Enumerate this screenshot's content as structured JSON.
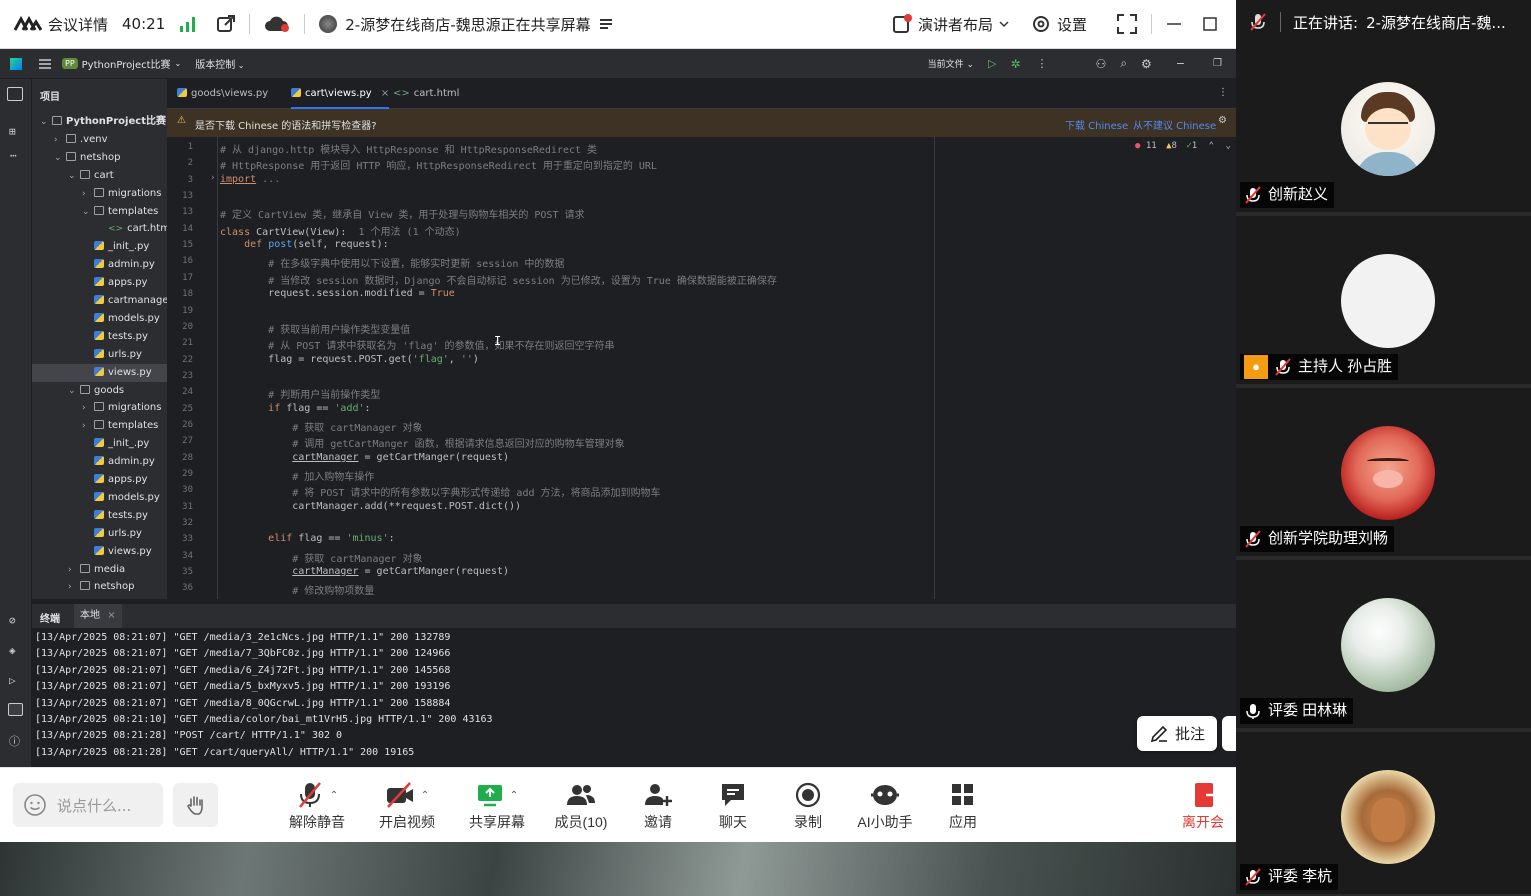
{
  "meeting": {
    "details_label": "会议详情",
    "timer": "40:21",
    "share_status": "2-源梦在线商店-魏思源正在共享屏幕",
    "layout_label": "演讲者布局",
    "settings_label": "设置"
  },
  "ide": {
    "project_name": "PythonProject比赛",
    "vcs_label": "版本控制",
    "run_config": "当前文件",
    "panel_title": "项目",
    "tree": [
      {
        "label": "PythonProject比赛",
        "depth": 0,
        "type": "folder",
        "open": true
      },
      {
        "label": ".venv",
        "depth": 1,
        "type": "folder",
        "open": false
      },
      {
        "label": "netshop",
        "depth": 1,
        "type": "folder",
        "open": true
      },
      {
        "label": "cart",
        "depth": 2,
        "type": "folder",
        "open": true
      },
      {
        "label": "migrations",
        "depth": 3,
        "type": "folder",
        "open": false
      },
      {
        "label": "templates",
        "depth": 3,
        "type": "folder",
        "open": true
      },
      {
        "label": "cart.html",
        "depth": 4,
        "type": "html"
      },
      {
        "label": "_init_.py",
        "depth": 3,
        "type": "py"
      },
      {
        "label": "admin.py",
        "depth": 3,
        "type": "py"
      },
      {
        "label": "apps.py",
        "depth": 3,
        "type": "py"
      },
      {
        "label": "cartmanager",
        "depth": 3,
        "type": "py"
      },
      {
        "label": "models.py",
        "depth": 3,
        "type": "py"
      },
      {
        "label": "tests.py",
        "depth": 3,
        "type": "py"
      },
      {
        "label": "urls.py",
        "depth": 3,
        "type": "py"
      },
      {
        "label": "views.py",
        "depth": 3,
        "type": "py",
        "selected": true
      },
      {
        "label": "goods",
        "depth": 2,
        "type": "folder",
        "open": true
      },
      {
        "label": "migrations",
        "depth": 3,
        "type": "folder",
        "open": false
      },
      {
        "label": "templates",
        "depth": 3,
        "type": "folder",
        "open": false
      },
      {
        "label": "_init_.py",
        "depth": 3,
        "type": "py"
      },
      {
        "label": "admin.py",
        "depth": 3,
        "type": "py"
      },
      {
        "label": "apps.py",
        "depth": 3,
        "type": "py"
      },
      {
        "label": "models.py",
        "depth": 3,
        "type": "py"
      },
      {
        "label": "tests.py",
        "depth": 3,
        "type": "py"
      },
      {
        "label": "urls.py",
        "depth": 3,
        "type": "py"
      },
      {
        "label": "views.py",
        "depth": 3,
        "type": "py"
      },
      {
        "label": "media",
        "depth": 2,
        "type": "folder",
        "open": false
      },
      {
        "label": "netshop",
        "depth": 2,
        "type": "folder",
        "open": false
      }
    ],
    "tabs": [
      {
        "label": "goods\\views.py",
        "active": false
      },
      {
        "label": "cart\\views.py",
        "active": true
      },
      {
        "label": "cart.html",
        "active": false
      }
    ],
    "notice": {
      "text": "是否下载 Chinese 的语法和拼写检查器?",
      "download": "下载 Chinese",
      "never": "从不建议 Chinese"
    },
    "inspection": {
      "errors": "11",
      "warnings": "8",
      "ok": "1"
    },
    "code_lines": [
      {
        "n": "1",
        "html": "<span class=\"cm\"># 从 django.http 模块导入 HttpResponse 和 HttpResponseRedirect 类</span>"
      },
      {
        "n": "2",
        "html": "<span class=\"cm\"># HttpResponse 用于返回 HTTP 响应，HttpResponseRedirect 用于重定向到指定的 URL</span>"
      },
      {
        "n": "3",
        "html": "<span class=\"kw ul\">import</span> <span class=\"cm\">...</span>"
      },
      {
        "n": "13",
        "html": ""
      },
      {
        "n": "13",
        "html": "<span class=\"cm\"># 定义 CartView 类，继承自 View 类，用于处理与购物车相关的 POST 请求</span>"
      },
      {
        "n": "14",
        "html": "<span class=\"kw\">class</span> CartView(View):  <span class=\"cm\">1 个用法 (1 个动态)</span>"
      },
      {
        "n": "15",
        "html": "    <span class=\"kw\">def</span> <span class=\"fn\">post</span>(self, request):"
      },
      {
        "n": "16",
        "html": "        <span class=\"cm\"># 在多级字典中使用以下设置，能够实时更新 session 中的数据</span>"
      },
      {
        "n": "17",
        "html": "        <span class=\"cm\"># 当修改 session 数据时，Django 不会自动标记 session 为已修改，设置为 True 确保数据能被正确保存</span>"
      },
      {
        "n": "18",
        "html": "        request.session.modified = <span class=\"kw\">True</span>"
      },
      {
        "n": "19",
        "html": ""
      },
      {
        "n": "20",
        "html": "        <span class=\"cm\"># 获取当前用户操作类型变量值</span>"
      },
      {
        "n": "21",
        "html": "        <span class=\"cm\"># 从 POST 请求中获取名为 'flag' 的参数值，如果不存在则返回空字符串</span>"
      },
      {
        "n": "22",
        "html": "        flag = request.POST.get(<span class=\"st\">'flag'</span>, <span class=\"st\">''</span>)"
      },
      {
        "n": "23",
        "html": ""
      },
      {
        "n": "24",
        "html": "        <span class=\"cm\"># 判断用户当前操作类型</span>"
      },
      {
        "n": "25",
        "html": "        <span class=\"kw\">if</span> flag == <span class=\"st\">'add'</span>:"
      },
      {
        "n": "26",
        "html": "            <span class=\"cm\"># 获取 cartManager 对象</span>"
      },
      {
        "n": "27",
        "html": "            <span class=\"cm\"># 调用 getCartManger 函数，根据请求信息返回对应的购物车管理对象</span>"
      },
      {
        "n": "28",
        "html": "            <span class=\"ul\">cartManager</span> = getCartManger(request)"
      },
      {
        "n": "29",
        "html": "            <span class=\"cm\"># 加入购物车操作</span>"
      },
      {
        "n": "30",
        "html": "            <span class=\"cm\"># 将 POST 请求中的所有参数以字典形式传递给 add 方法，将商品添加到购物车</span>"
      },
      {
        "n": "31",
        "html": "            cartManager.add(**request.POST.dict())"
      },
      {
        "n": "32",
        "html": ""
      },
      {
        "n": "33",
        "html": "        <span class=\"kw\">elif</span> flag == <span class=\"st\">'minus'</span>:"
      },
      {
        "n": "34",
        "html": "            <span class=\"cm\"># 获取 cartManager 对象</span>"
      },
      {
        "n": "35",
        "html": "            <span class=\"ul\">cartManager</span> = getCartManger(request)"
      },
      {
        "n": "36",
        "html": "            <span class=\"cm\"># 修改购物项数量</span>"
      }
    ],
    "terminal": {
      "title": "终端",
      "tab": "本地",
      "lines": [
        "[13/Apr/2025 08:21:07] \"GET /media/3_2e1cNcs.jpg HTTP/1.1\" 200 132789",
        "[13/Apr/2025 08:21:07] \"GET /media/7_3QbFC0z.jpg HTTP/1.1\" 200 124966",
        "[13/Apr/2025 08:21:07] \"GET /media/6_Z4j72Ft.jpg HTTP/1.1\" 200 145568",
        "[13/Apr/2025 08:21:07] \"GET /media/5_bxMyxv5.jpg HTTP/1.1\" 200 193196",
        "[13/Apr/2025 08:21:07] \"GET /media/8_0QGcrwL.jpg HTTP/1.1\" 200 158884",
        "[13/Apr/2025 08:21:10] \"GET /media/color/bai_mt1VrH5.jpg HTTP/1.1\" 200 43163",
        "[13/Apr/2025 08:21:28] \"POST /cart/ HTTP/1.1\" 302 0",
        "[13/Apr/2025 08:21:28] \"GET /cart/queryAll/ HTTP/1.1\" 200 19165"
      ]
    }
  },
  "annotate_label": "批注",
  "toolbar": {
    "chat_placeholder": "说点什么...",
    "buttons": [
      {
        "label": "解除静音",
        "icon": "mic-muted-icon"
      },
      {
        "label": "开启视频",
        "icon": "camera-off-icon"
      },
      {
        "label": "共享屏幕",
        "icon": "share-screen-icon"
      },
      {
        "label": "成员(10)",
        "icon": "members-icon"
      },
      {
        "label": "邀请",
        "icon": "invite-icon"
      },
      {
        "label": "聊天",
        "icon": "chat-icon"
      },
      {
        "label": "录制",
        "icon": "record-icon"
      },
      {
        "label": "AI小助手",
        "icon": "ai-assistant-icon"
      },
      {
        "label": "应用",
        "icon": "apps-icon"
      }
    ],
    "leave_label": "离开会"
  },
  "speaking": {
    "prefix": "正在讲话:",
    "name": "2-源梦在线商店-魏..."
  },
  "participants": [
    {
      "name": "创新赵义",
      "role": ""
    },
    {
      "name": "主持人 孙占胜",
      "role": "host"
    },
    {
      "name": "创新学院助理刘畅",
      "role": ""
    },
    {
      "name": "评委 田林琳",
      "role": "mic-on"
    },
    {
      "name": "评委 李杭",
      "role": ""
    }
  ]
}
